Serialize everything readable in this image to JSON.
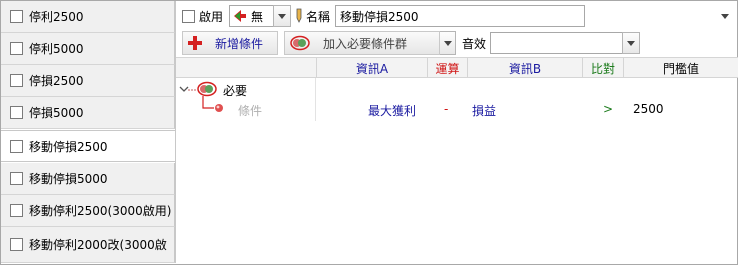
{
  "left_list": [
    {
      "label": "停利2500",
      "selected": false
    },
    {
      "label": "停利5000",
      "selected": false
    },
    {
      "label": "停損2500",
      "selected": false
    },
    {
      "label": "停損5000",
      "selected": false
    },
    {
      "label": "移動停損2500",
      "selected": true
    },
    {
      "label": "移動停損5000",
      "selected": false
    },
    {
      "label": "移動停利2500(3000啟用)",
      "selected": false
    },
    {
      "label": "移動停利2000改(3000啟",
      "selected": false
    }
  ],
  "toolbar": {
    "enable_label": "啟用",
    "level_value": "無",
    "name_label": "名稱",
    "name_value": "移動停損2500",
    "add_condition_label": "新增條件",
    "add_group_label": "加入必要條件群",
    "sound_label": "音效",
    "sound_value": ""
  },
  "grid": {
    "headers": [
      "資訊A",
      "運算",
      "資訊B",
      "比對",
      "門檻值"
    ],
    "group_label": "必要",
    "condition_label": "條件",
    "row": {
      "info_a": "最大獲利",
      "op": "-",
      "info_b": "損益",
      "compare": ">",
      "threshold": "2500"
    }
  },
  "colors": {
    "blue_text": "#1a1aa0",
    "red_text": "#d01515",
    "green_text": "#1a7a1a"
  }
}
